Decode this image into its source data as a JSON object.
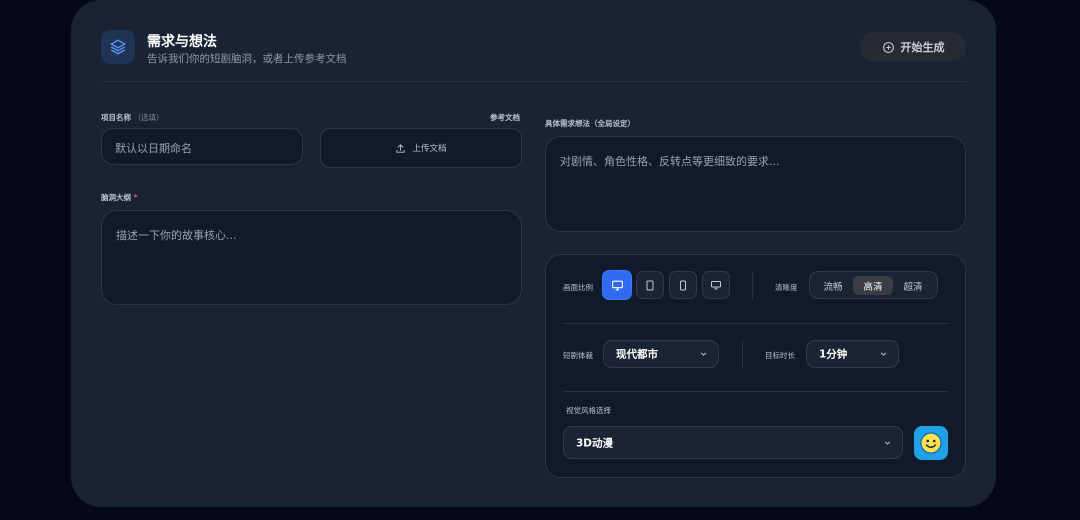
{
  "header": {
    "title": "需求与想法",
    "subtitle": "告诉我们你的短剧脑洞，或者上传参考文档",
    "generate_label": "开始生成",
    "logo_icon": "layers-icon"
  },
  "form": {
    "project_name_label": "项目名称",
    "project_name_optional": "（选填）",
    "project_name_placeholder": "默认以日期命名",
    "reference_doc_label": "参考文档",
    "upload_label": "上传文档",
    "outline_label": "脑洞大纲",
    "outline_required": "*",
    "outline_placeholder": "描述一下你的故事核心...",
    "requirements_label": "具体需求想法（全局设定）",
    "requirements_placeholder": "对剧情、角色性格、反转点等更细致的要求..."
  },
  "settings": {
    "aspect_label": "画面比例",
    "aspect_options": [
      "monitor-icon",
      "tablet-icon",
      "phone-icon",
      "monitor-small-icon"
    ],
    "aspect_selected": 0,
    "quality_label": "清晰度",
    "quality_options": [
      "流畅",
      "高清",
      "超清"
    ],
    "quality_selected": "高清",
    "genre_label": "短剧体裁",
    "genre_value": "现代都市",
    "duration_label": "目标时长",
    "duration_value": "1分钟",
    "style_label": "视觉风格选择",
    "style_value": "3D动漫",
    "style_icon": "smile-icon"
  },
  "colors": {
    "accent": "#2f6bf0",
    "required": "#e8505b",
    "style_icon_bg": "#1ea1e6"
  }
}
